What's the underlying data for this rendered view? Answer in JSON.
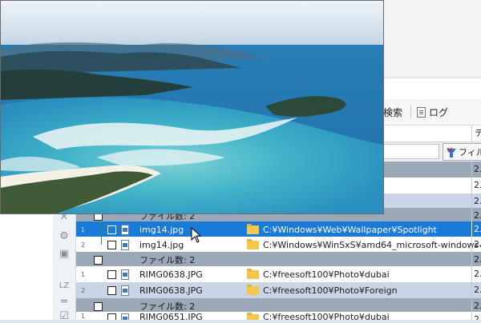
{
  "toolbar": {
    "search_label": "検索",
    "log_label": "ログ"
  },
  "header": {
    "right_label": "テ"
  },
  "filter": {
    "button_label": "フィル"
  },
  "groups": [
    {
      "label": "ファイル数: 2"
    },
    {
      "label": "ファイル数: 2"
    },
    {
      "label": "ファイル数: 2"
    }
  ],
  "rows": [
    {
      "num": "1",
      "name": "img14.jpg",
      "path": "C:¥Windows¥Web¥Wallpaper¥Spotlight",
      "right": "2."
    },
    {
      "num": "2",
      "name": "img14.jpg",
      "path": "C:¥Windows¥WinSxS¥amd64_microsoft-windows-s......",
      "right": "2."
    },
    {
      "num": "1",
      "name": "RIMG0638.JPG",
      "path": "C:¥freesoft100¥Photo¥dubai",
      "right": "2."
    },
    {
      "num": "2",
      "name": "RIMG0638.JPG",
      "path": "C:¥freesoft100¥Photo¥Foreign",
      "right": "2."
    },
    {
      "num": "1",
      "name": "RIMG0651.JPG",
      "path": "C:¥freesoft100¥Photo¥dubai",
      "right": "2."
    }
  ],
  "upper_rows_right": [
    "2.",
    "2.",
    "2.",
    "2."
  ],
  "group_right": "2.",
  "side_labels": {
    "lz": "LZ"
  },
  "colors": {
    "group_row": "#9aa8b7",
    "selected_row": "#1a7ad8",
    "alt_row": "#c9d5e6"
  }
}
